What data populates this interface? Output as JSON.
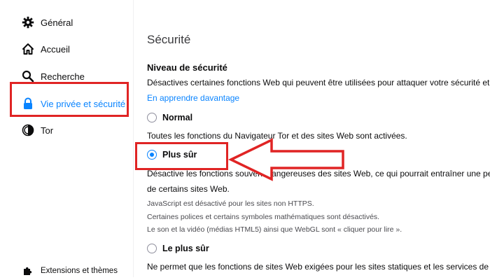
{
  "sidebar": {
    "items": [
      {
        "label": "Général",
        "icon": "gear-icon"
      },
      {
        "label": "Accueil",
        "icon": "home-icon"
      },
      {
        "label": "Recherche",
        "icon": "search-icon"
      },
      {
        "label": "Vie privée et sécurité",
        "icon": "lock-icon",
        "selected": true
      },
      {
        "label": "Tor",
        "icon": "tor-onion-icon"
      }
    ],
    "extensions_label": "Extensions et thèmes"
  },
  "main": {
    "section_title": "Sécurité",
    "level_title": "Niveau de sécurité",
    "level_desc": "Désactives certaines fonctions Web qui peuvent être utilisées pour attaquer votre sécurité et",
    "learn_more": "En apprendre davantage",
    "options": {
      "normal": {
        "label": "Normal",
        "desc": "Toutes les fonctions du Navigateur Tor et des sites Web sont activées."
      },
      "safer": {
        "label": "Plus sûr",
        "desc1": "Désactive les fonctions souvent dangereuses des sites Web, ce qui pourrait entraîner une per",
        "desc2": "de certains sites Web.",
        "details": [
          "JavaScript est désactivé pour les sites non HTTPS.",
          "Certaines polices et certains symboles mathématiques sont désactivés.",
          "Le son et la vidéo (médias HTML5) ainsi que WebGL sont « cliquer pour lire »."
        ]
      },
      "safest": {
        "label": "Le plus sûr",
        "desc": "Ne permet que les fonctions de sites Web exigées pour les sites statiques et les services de b"
      }
    },
    "selected_option": "safer"
  },
  "colors": {
    "accent": "#0a84ff",
    "annotation": "#e02424"
  }
}
